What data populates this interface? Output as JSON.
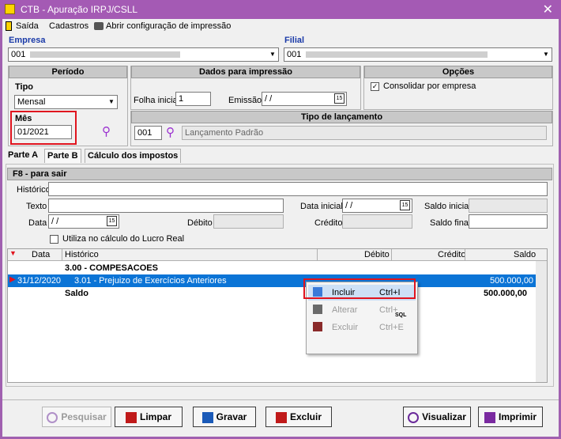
{
  "window": {
    "title": "CTB - Apuração IRPJ/CSLL",
    "close": "✕"
  },
  "menu": {
    "exit": "Saída",
    "cadastros": "Cadastros",
    "print_config": "Abrir configuração de impressão"
  },
  "empresa": {
    "label": "Empresa",
    "value": "001"
  },
  "filial": {
    "label": "Filial",
    "value": "001"
  },
  "periodo": {
    "header": "Período",
    "tipo_label": "Tipo",
    "tipo_value": "Mensal",
    "mes_label": "Mês",
    "mes_value": "01/2021"
  },
  "dados_impressao": {
    "header": "Dados para impressão",
    "folha_label": "Folha inicial",
    "folha_value": "1",
    "emissao_label": "Emissão",
    "emissao_value": " / /"
  },
  "opcoes": {
    "header": "Opções",
    "consolidar_label": "Consolidar por empresa",
    "consolidar_checked": "✓"
  },
  "tipo_lancamento": {
    "header": "Tipo de lançamento",
    "code": "001",
    "description": "Lançamento Padrão"
  },
  "tabs": [
    "Parte A",
    "Parte B",
    "Cálculo dos impostos"
  ],
  "partb": {
    "section_header": "F8 - para sair",
    "historico_label": "Histórico",
    "texto_label": "Texto",
    "data_label": "Data",
    "data_value": " / /",
    "debito_label": "Débito",
    "data_inicial_label": "Data inicial",
    "data_inicial_value": " / /",
    "credito_label": "Crédito",
    "saldo_inicial_label": "Saldo inicial",
    "saldo_final_label": "Saldo final",
    "lucro_real_label": "Utiliza no cálculo do Lucro Real"
  },
  "grid": {
    "columns": [
      "Data",
      "Histórico",
      "Débito",
      "Crédito",
      "Saldo"
    ],
    "rows": [
      {
        "data": "",
        "historico": "3.00 - COMPESACOES",
        "debito": "",
        "credito": "",
        "saldo": ""
      },
      {
        "data": "31/12/2020",
        "historico": "3.01 - Prejuizo de Exercícios Anteriores",
        "debito": "",
        "credito": "",
        "saldo": "500.000,00"
      },
      {
        "data": "",
        "historico": "Saldo",
        "debito": "",
        "credito": "",
        "saldo": "500.000,00"
      }
    ]
  },
  "context_menu": {
    "incluir": {
      "label": "Incluir",
      "shortcut": "Ctrl+I"
    },
    "alterar": {
      "label": "Alterar",
      "shortcut": "Ctrl+"
    },
    "excluir": {
      "label": "Excluir",
      "shortcut": "Ctrl+E"
    },
    "sql_badge": "SQL"
  },
  "buttons": {
    "pesquisar": "Pesquisar",
    "limpar": "Limpar",
    "gravar": "Gravar",
    "excluir": "Excluir",
    "visualizar": "Visualizar",
    "imprimir": "Imprimir"
  },
  "colors": {
    "title_bar": "#a45ab4",
    "selection": "#0b74d6",
    "highlight": "#e0141e",
    "label_blue": "#1a3aa8"
  }
}
